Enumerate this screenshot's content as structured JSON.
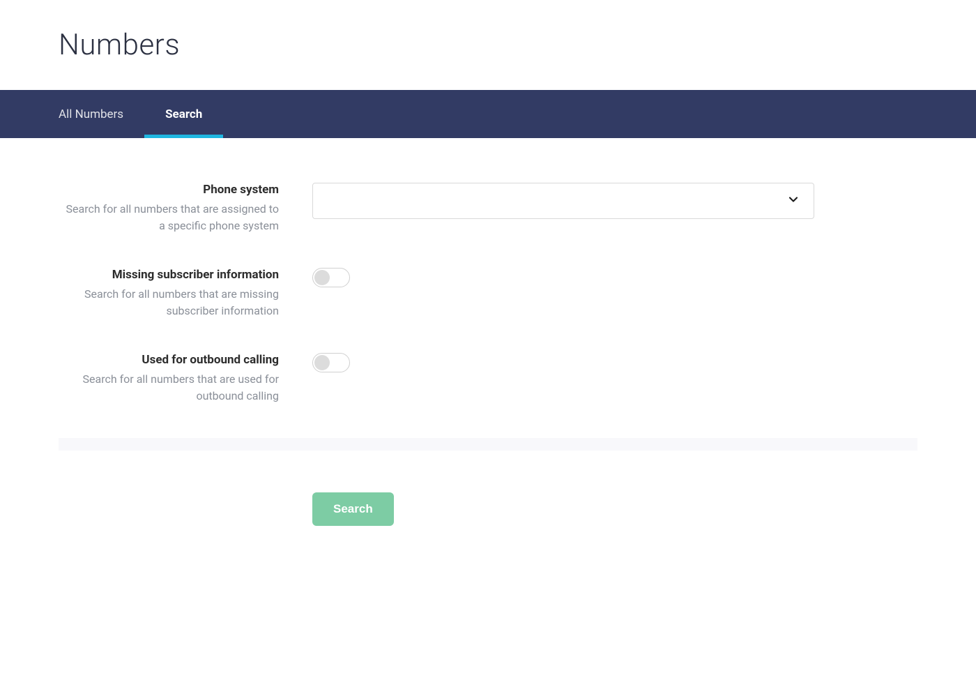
{
  "header": {
    "title": "Numbers"
  },
  "tabs": [
    {
      "label": "All Numbers",
      "active": false
    },
    {
      "label": "Search",
      "active": true
    }
  ],
  "form": {
    "phone_system": {
      "label": "Phone system",
      "description": "Search for all numbers that are assigned to a specific phone system",
      "value": ""
    },
    "missing_subscriber": {
      "label": "Missing subscriber information",
      "description": "Search for all numbers that are missing subscriber information",
      "enabled": false
    },
    "outbound_calling": {
      "label": "Used for outbound calling",
      "description": "Search for all numbers that are used for outbound calling",
      "enabled": false
    }
  },
  "actions": {
    "search_label": "Search"
  }
}
